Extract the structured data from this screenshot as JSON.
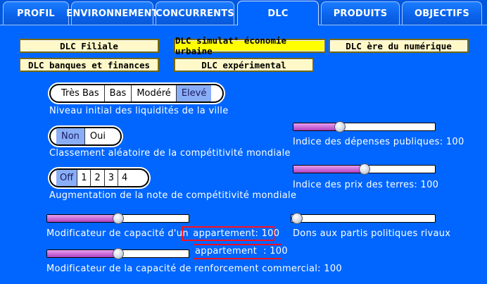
{
  "tabs": [
    {
      "label": "PROFIL"
    },
    {
      "label": "ENVIRONNEMENT"
    },
    {
      "label": "CONCURRENTS"
    },
    {
      "label": "DLC"
    },
    {
      "label": "PRODUITS"
    },
    {
      "label": "OBJECTIFS"
    }
  ],
  "active_tab": "DLC",
  "dlc_buttons": [
    {
      "label": "DLC Filiale",
      "selected": false
    },
    {
      "label": "DLC simulat° économie urbaine",
      "selected": true
    },
    {
      "label": "DLC ère du numérique",
      "selected": false
    },
    {
      "label": "DLC banques et finances",
      "selected": false
    },
    {
      "label": "DLC expérimental",
      "selected": false
    }
  ],
  "liquidity": {
    "options": [
      "Très Bas",
      "Bas",
      "Modéré",
      "Elevé"
    ],
    "selected": "Elevé",
    "label": "Niveau initial des liquidités de la ville"
  },
  "random_competitiveness": {
    "options": [
      "Non",
      "Oui"
    ],
    "selected": "Non",
    "label": "Classement aléatoire de la compétitivité mondiale"
  },
  "competitiveness_increase": {
    "options": [
      "Off",
      "1",
      "2",
      "3",
      "4"
    ],
    "selected": "Off",
    "label": "Augmentation de la note de compétitivité mondiale"
  },
  "public_spending": {
    "label": "Indice des dépenses publiques:",
    "value": "100",
    "fraction": 0.33
  },
  "land_price": {
    "label": "Indice des prix des terres:",
    "value": "100",
    "fraction": 0.5
  },
  "apartment_capacity": {
    "label_prefix": "Modificateur de capacité d'un",
    "label_suffix": "appartement:",
    "value": "100",
    "fraction": 0.5
  },
  "apartment_note": {
    "text": "appartement",
    "sep": ":",
    "value": "100"
  },
  "political_donations": {
    "label": "Dons aux partis politiques rivaux",
    "fraction": 0.0
  },
  "commercial_capacity": {
    "label": "Modificateur de la capacité de renforcement commercial:",
    "value": "100",
    "fraction": 0.5
  },
  "colors": {
    "background": "#0066ff",
    "dlc_selected": "#ffff00",
    "dlc_normal": "#fff8c8",
    "highlight": "#ff1020",
    "slider_fill": "#c050d0"
  }
}
